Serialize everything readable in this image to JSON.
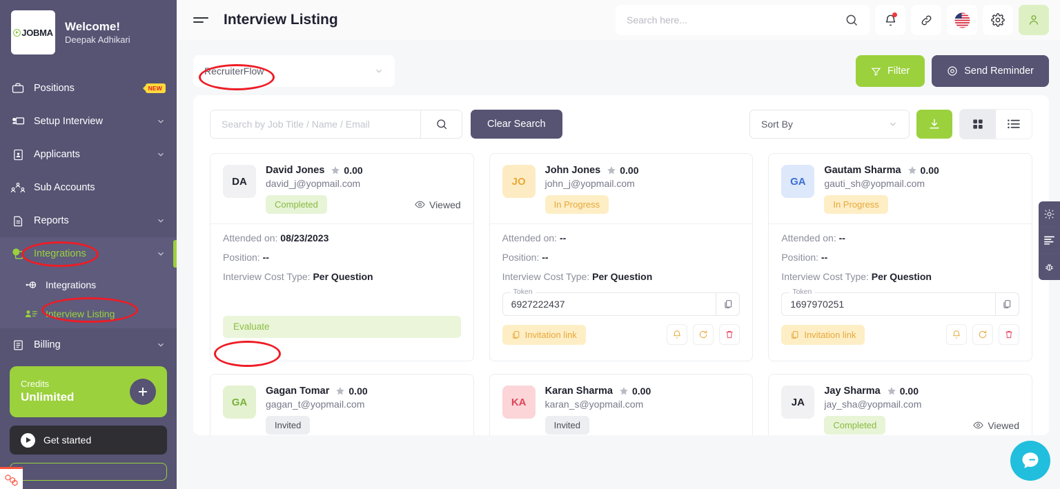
{
  "sidebar": {
    "brand": {
      "logo_text": "JOBMA",
      "welcome": "Welcome!",
      "user": "Deepak Adhikari"
    },
    "items": [
      {
        "label": "Positions",
        "icon": "briefcase-icon",
        "badge": "NEW",
        "chevron": false,
        "active": false
      },
      {
        "label": "Setup Interview",
        "icon": "presentation-icon",
        "badge": "",
        "chevron": true,
        "active": false
      },
      {
        "label": "Applicants",
        "icon": "id-card-icon",
        "badge": "",
        "chevron": true,
        "active": false
      },
      {
        "label": "Sub Accounts",
        "icon": "users-icon",
        "badge": "",
        "chevron": false,
        "active": false
      },
      {
        "label": "Reports",
        "icon": "report-icon",
        "badge": "",
        "chevron": true,
        "active": false
      },
      {
        "label": "Integrations",
        "icon": "integrations-icon",
        "badge": "",
        "chevron": true,
        "active": true
      }
    ],
    "subitems": [
      {
        "label": "Integrations",
        "icon": "plug-icon",
        "active": false
      },
      {
        "label": "Interview Listing",
        "icon": "user-list-icon",
        "active": true
      }
    ],
    "billing": {
      "label": "Billing",
      "icon": "billing-icon",
      "chevron": true
    },
    "credits": {
      "label": "Credits",
      "value": "Unlimited",
      "add_icon": "plus-icon"
    },
    "get_started": {
      "label": "Get started",
      "icon": "play-icon"
    }
  },
  "topbar": {
    "menu_icon": "hamburger-icon",
    "title": "Interview Listing",
    "search": {
      "value": "",
      "placeholder": "Search here..."
    },
    "icons": [
      "bell-icon",
      "link-icon",
      "flag-us-icon",
      "gear-icon",
      "user-icon"
    ]
  },
  "filterbar": {
    "integration_select": {
      "value": "RecruiterFlow"
    },
    "filter_button": "Filter",
    "reminder_button": "Send Reminder"
  },
  "toolbar": {
    "search": {
      "value": "",
      "placeholder": "Search by Job Title / Name / Email"
    },
    "clear_search": "Clear Search",
    "sort_by": {
      "value": "Sort By"
    },
    "download_icon": "download-icon",
    "grid_view_icon": "grid-view-icon",
    "list_view_icon": "list-view-icon"
  },
  "labels": {
    "attended_on": "Attended on:",
    "position": "Position:",
    "cost_type": "Interview Cost Type:",
    "token": "Token",
    "viewed": "Viewed",
    "evaluate": "Evaluate",
    "invitation_link": "Invitation link"
  },
  "cards": [
    {
      "initials": "DA",
      "avatar_bg": "#f1f1f3",
      "avatar_color": "#20222e",
      "name": "David Jones",
      "rating": "0.00",
      "email": "david_j@yopmail.com",
      "status": "Completed",
      "status_type": "completed",
      "viewed": "Viewed",
      "attended_on": "08/23/2023",
      "position": "--",
      "cost_type": "Per Question",
      "token": "",
      "has_token": false,
      "has_evaluate": true
    },
    {
      "initials": "JO",
      "avatar_bg": "#fdecc3",
      "avatar_color": "#e8a83a",
      "name": "John Jones",
      "rating": "0.00",
      "email": "john_j@yopmail.com",
      "status": "In Progress",
      "status_type": "progress",
      "viewed": "",
      "attended_on": "--",
      "position": "--",
      "cost_type": "Per Question",
      "token": "6927222437",
      "has_token": true,
      "has_evaluate": false
    },
    {
      "initials": "GA",
      "avatar_bg": "#dde8fb",
      "avatar_color": "#3b6fd4",
      "name": "Gautam Sharma",
      "rating": "0.00",
      "email": "gauti_sh@yopmail.com",
      "status": "In Progress",
      "status_type": "progress",
      "viewed": "",
      "attended_on": "--",
      "position": "--",
      "cost_type": "Per Question",
      "token": "1697970251",
      "has_token": true,
      "has_evaluate": false
    }
  ],
  "cards_row2": [
    {
      "initials": "GA",
      "avatar_bg": "#e4f2d1",
      "avatar_color": "#79b23a",
      "name": "Gagan Tomar",
      "rating": "0.00",
      "email": "gagan_t@yopmail.com",
      "status": "Invited",
      "status_type": "invited",
      "viewed": ""
    },
    {
      "initials": "KA",
      "avatar_bg": "#fbd5d8",
      "avatar_color": "#e0455a",
      "name": "Karan Sharma",
      "rating": "0.00",
      "email": "karan_s@yopmail.com",
      "status": "Invited",
      "status_type": "invited",
      "viewed": ""
    },
    {
      "initials": "JA",
      "avatar_bg": "#f1f1f3",
      "avatar_color": "#20222e",
      "name": "Jay Sharma",
      "rating": "0.00",
      "email": "jay_sha@yopmail.com",
      "status": "Completed",
      "status_type": "completed",
      "viewed": "Viewed"
    }
  ],
  "right_rail": [
    "brightness-icon",
    "layout-lines-icon",
    "bug-icon"
  ],
  "chat": {
    "icon": "chat-bubble-icon"
  },
  "colors": {
    "sidebar": "#565373",
    "accent_green": "#9bd13d",
    "status_completed": "#89b942",
    "status_progress": "#e8a83a",
    "annotation_red": "#ee1c25",
    "chat_blue": "#21bedd"
  }
}
